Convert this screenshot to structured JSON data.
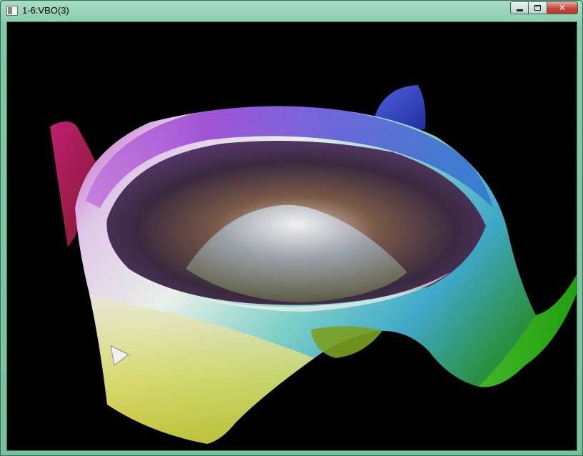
{
  "window": {
    "title": "1-6:VBO(3)",
    "icon": "app-window-icon",
    "controls": {
      "minimize": "minimize-icon",
      "maximize": "maximize-icon",
      "close": "close-icon",
      "close_glyph": "✕"
    }
  },
  "viewport": {
    "background": "#000000",
    "scene": "rainbow-shaded-3d-surface-mesh",
    "colors": {
      "magenta": "#c050c8",
      "purple": "#8a2ad0",
      "blue": "#2f4fd8",
      "cyan": "#3fa8c8",
      "green": "#30b020",
      "yellow": "#e0e030",
      "red": "#a02040",
      "white": "#f4f4ee"
    }
  }
}
